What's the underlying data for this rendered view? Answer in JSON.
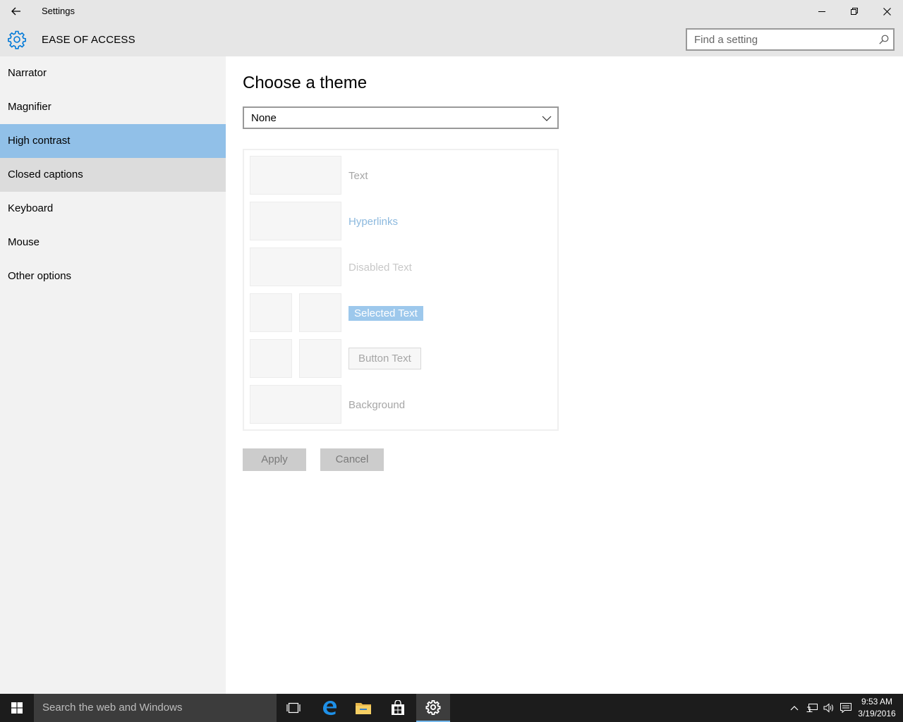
{
  "window": {
    "title": "Settings",
    "section": "EASE OF ACCESS"
  },
  "search": {
    "placeholder": "Find a setting"
  },
  "sidebar": {
    "items": [
      {
        "label": "Narrator"
      },
      {
        "label": "Magnifier"
      },
      {
        "label": "High contrast"
      },
      {
        "label": "Closed captions"
      },
      {
        "label": "Keyboard"
      },
      {
        "label": "Mouse"
      },
      {
        "label": "Other options"
      }
    ],
    "selected": "High contrast"
  },
  "main": {
    "title": "Choose a theme",
    "theme_value": "None",
    "preview": {
      "text": "Text",
      "hyperlinks": "Hyperlinks",
      "disabled": "Disabled Text",
      "selected": "Selected Text",
      "button": "Button Text",
      "background": "Background"
    },
    "apply_label": "Apply",
    "cancel_label": "Cancel"
  },
  "taskbar": {
    "search_placeholder": "Search the web and Windows",
    "time": "9:53 AM",
    "date": "3/19/2016"
  },
  "colors": {
    "accent": "#0078d7",
    "selected_nav": "#91c0e8",
    "taskbar": "#1c1c1c"
  },
  "icons": [
    "back-arrow-icon",
    "gear-icon",
    "search-icon",
    "chevron-down-icon",
    "windows-logo-icon",
    "task-view-icon",
    "edge-icon",
    "file-explorer-icon",
    "store-icon",
    "settings-icon",
    "chevron-up-icon",
    "network-icon",
    "volume-icon",
    "action-center-icon"
  ]
}
